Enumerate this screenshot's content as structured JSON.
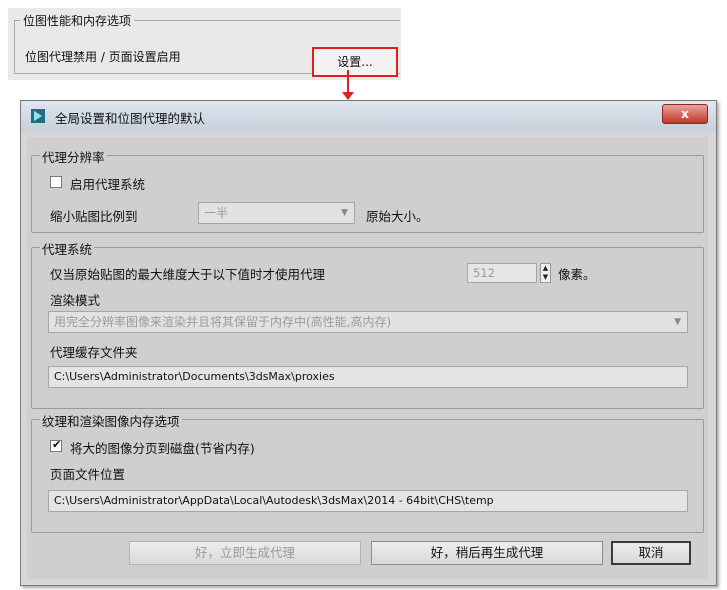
{
  "snippet": {
    "group_title": "位图性能和内存选项",
    "status_text": "位图代理禁用 / 页面设置启用",
    "setup_button": "设置..."
  },
  "dialog": {
    "title": "全局设置和位图代理的默认",
    "close_label": "x",
    "proxy_resolution": {
      "legend": "代理分辨率",
      "enable_label": "启用代理系统",
      "enable_checked": false,
      "downscale_label": "缩小贴图比例到",
      "downscale_value": "一半",
      "original_size_label": "原始大小。"
    },
    "proxy_system": {
      "legend": "代理系统",
      "threshold_label": "仅当原始贴图的最大维度大于以下值时才使用代理",
      "threshold_value": "512",
      "pixels_label": "像素。",
      "render_mode_label": "渲染模式",
      "render_mode_value": "用完全分辨率图像来渲染并且将其保留于内存中(高性能,高内存)",
      "cache_folder_label": "代理缓存文件夹",
      "cache_folder_path": "C:\\Users\\Administrator\\Documents\\3dsMax\\proxies"
    },
    "texture_memory": {
      "legend": "纹理和渲染图像内存选项",
      "page_to_disk_label": "将大的图像分页到磁盘(节省内存)",
      "page_to_disk_checked": true,
      "page_file_label": "页面文件位置",
      "page_file_path": "C:\\Users\\Administrator\\AppData\\Local\\Autodesk\\3dsMax\\2014 - 64bit\\CHS\\temp"
    },
    "buttons": {
      "generate_now": "好，立即生成代理",
      "generate_later": "好，稍后再生成代理",
      "cancel": "取消"
    }
  },
  "colors": {
    "highlight_red": "#e0201f",
    "dialog_bg": "#d6d6d6",
    "close_button": "#c3362a"
  },
  "icons": [
    "app-icon",
    "checkbox-icon",
    "dropdown-arrow-icon",
    "spinner-icon",
    "close-icon"
  ]
}
